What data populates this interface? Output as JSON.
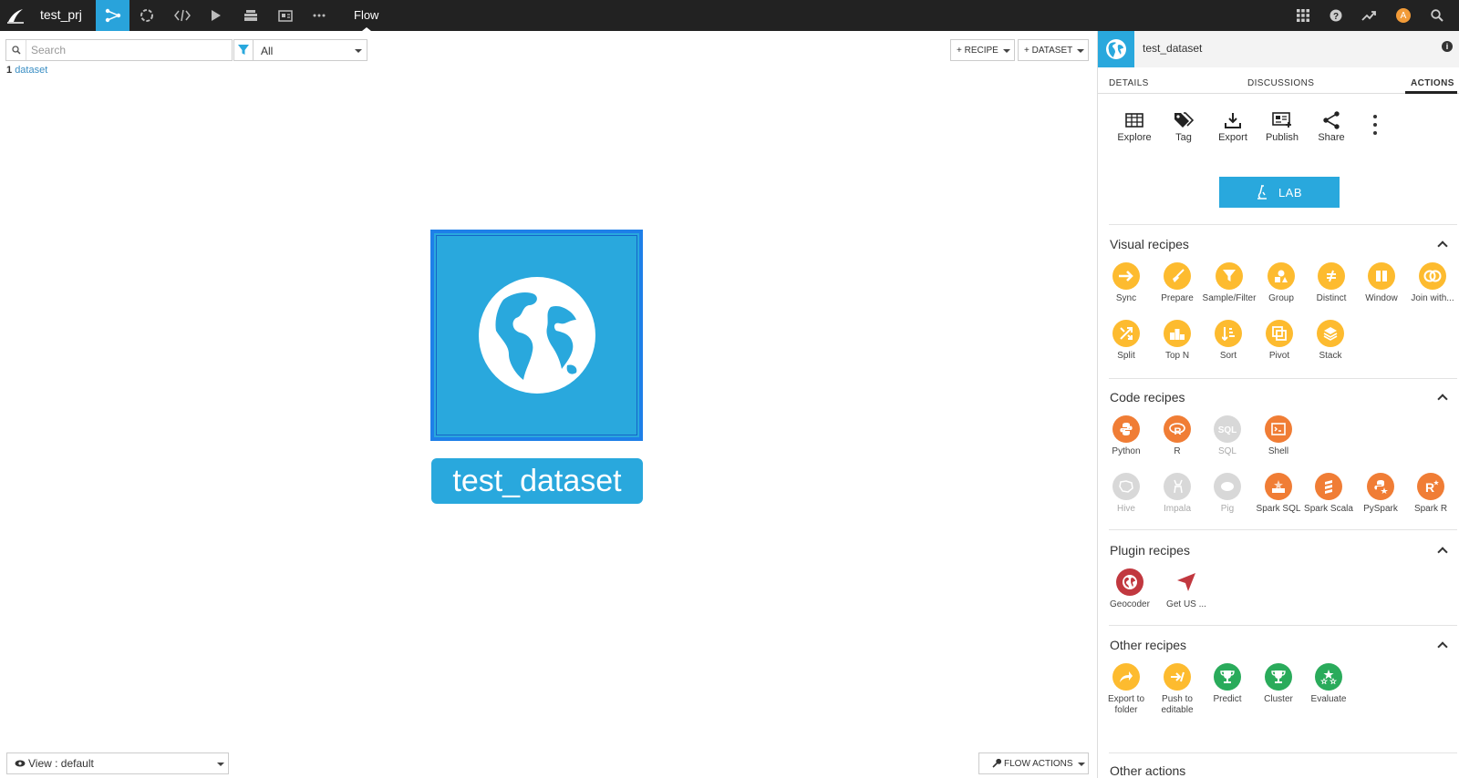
{
  "topbar": {
    "project_name": "test_prj",
    "current_view": "Flow",
    "avatar_letter": "A"
  },
  "toolbar": {
    "search_placeholder": "Search",
    "filter_value": "All",
    "count_number": "1",
    "count_label": "dataset",
    "recipe_button": "+ RECIPE",
    "dataset_button": "+ DATASET"
  },
  "canvas": {
    "dataset_name": "test_dataset",
    "view_label": "View : default",
    "flow_actions_label": "FLOW ACTIONS"
  },
  "panel": {
    "title": "test_dataset",
    "tabs": [
      "DETAILS",
      "DISCUSSIONS",
      "ACTIONS"
    ],
    "active_tab": "ACTIONS",
    "actions": [
      "Explore",
      "Tag",
      "Export",
      "Publish",
      "Share"
    ],
    "lab_label": "LAB",
    "sections": {
      "visual": {
        "title": "Visual recipes",
        "items": [
          "Sync",
          "Prepare",
          "Sample/Filter",
          "Group",
          "Distinct",
          "Window",
          "Join with...",
          "Split",
          "Top N",
          "Sort",
          "Pivot",
          "Stack"
        ]
      },
      "code": {
        "title": "Code recipes",
        "items": [
          "Python",
          "R",
          "SQL",
          "Shell",
          "Hive",
          "Impala",
          "Pig",
          "Spark SQL",
          "Spark Scala",
          "PySpark",
          "Spark R"
        ]
      },
      "plugin": {
        "title": "Plugin recipes",
        "items": [
          "Geocoder",
          "Get US ..."
        ]
      },
      "other": {
        "title": "Other recipes",
        "items": [
          "Export to folder",
          "Push to editable",
          "Predict",
          "Cluster",
          "Evaluate"
        ]
      },
      "other_actions": {
        "title": "Other actions"
      }
    }
  },
  "colors": {
    "accent": "#29a8dd",
    "selection": "#1e7fe8",
    "topbar": "#222222",
    "visual_recipe": "#fdbb2f",
    "code_recipe": "#f07d35",
    "disabled_recipe": "#d8d8d8",
    "plugin_recipe": "#c1383f",
    "ml_recipe": "#2aab5b"
  }
}
